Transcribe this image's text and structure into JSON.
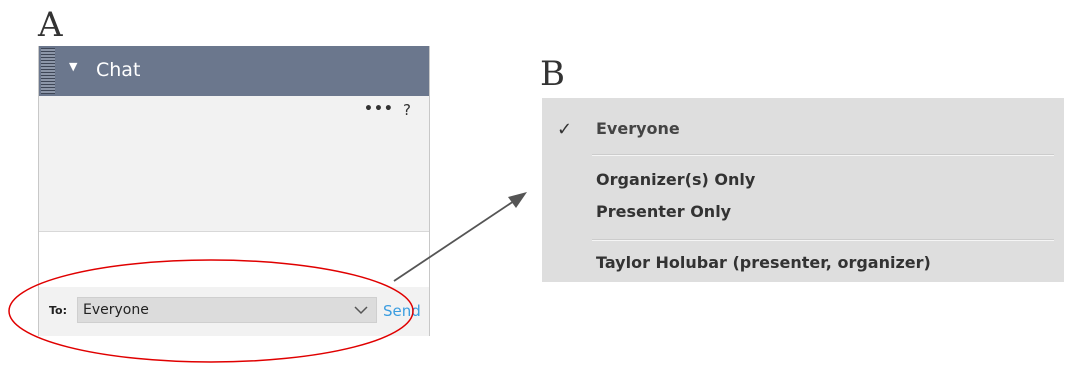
{
  "labels": {
    "panel_a": "A",
    "panel_b": "B"
  },
  "chat": {
    "title": "Chat",
    "more_icon": "•••",
    "help_icon": "?",
    "to_label": "To:",
    "to_value": "Everyone",
    "send_label": "Send"
  },
  "menu": {
    "check": "✓",
    "items": [
      "Everyone",
      "Organizer(s) Only",
      "Presenter Only",
      "Taylor Holubar (presenter, organizer)"
    ]
  },
  "colors": {
    "header": "#6b778d",
    "send": "#3b9de0",
    "highlight_ellipse": "#e00000",
    "arrow": "#555555",
    "menu_bg": "#dedede"
  }
}
